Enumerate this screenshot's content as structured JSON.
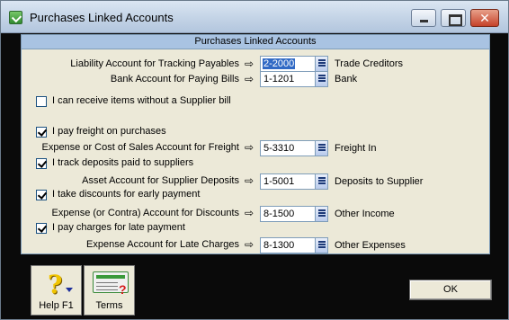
{
  "window": {
    "title": "Purchases Linked Accounts"
  },
  "panel": {
    "header": "Purchases Linked Accounts"
  },
  "rows": {
    "liability": {
      "label": "Liability Account for Tracking Payables",
      "account": "2-2000",
      "name": "Trade Creditors"
    },
    "bank": {
      "label": "Bank Account for Paying Bills",
      "account": "1-1201",
      "name": "Bank"
    },
    "freight": {
      "label": "Expense or Cost of Sales Account for Freight",
      "account": "5-3310",
      "name": "Freight In"
    },
    "deposits": {
      "label": "Asset Account for Supplier Deposits",
      "account": "1-5001",
      "name": "Deposits to Supplier"
    },
    "discounts": {
      "label": "Expense (or Contra) Account for Discounts",
      "account": "8-1500",
      "name": "Other Income"
    },
    "late": {
      "label": "Expense Account for Late Charges",
      "account": "8-1300",
      "name": "Other Expenses"
    }
  },
  "checkboxes": {
    "receive_without_bill": {
      "label": "I can receive items without a Supplier bill",
      "checked": false
    },
    "pay_freight": {
      "label": "I pay freight on purchases",
      "checked": true
    },
    "track_deposits": {
      "label": "I track deposits paid to suppliers",
      "checked": true
    },
    "take_discounts": {
      "label": "I take discounts for early payment",
      "checked": true
    },
    "pay_late": {
      "label": "I pay charges for late payment",
      "checked": true
    }
  },
  "buttons": {
    "help": "Help F1",
    "terms": "Terms",
    "ok": "OK"
  },
  "icons": {
    "app": "checkmark-app-icon",
    "link_arrow": "arrow-link-icon",
    "lookup": "list-lookup-icon"
  }
}
